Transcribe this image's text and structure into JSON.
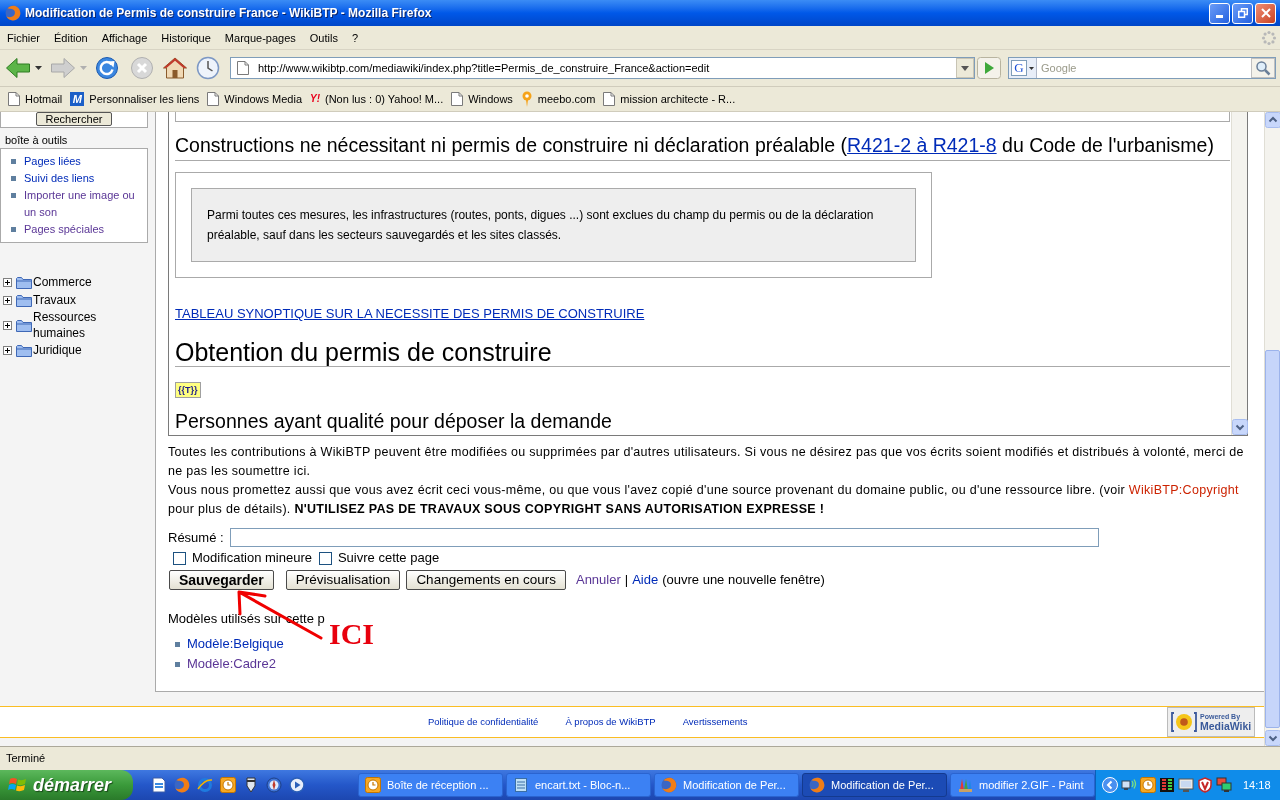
{
  "window": {
    "title": "Modification de Permis de construire France - WikiBTP - Mozilla Firefox"
  },
  "menu": [
    {
      "label": "Fichier"
    },
    {
      "label": "Édition"
    },
    {
      "label": "Affichage"
    },
    {
      "label": "Historique"
    },
    {
      "label": "Marque-pages"
    },
    {
      "label": "Outils"
    },
    {
      "label": "?"
    }
  ],
  "nav_buttons": [
    {
      "kind": "back",
      "disabled": false
    },
    {
      "kind": "forward",
      "disabled": true
    },
    {
      "kind": "reload",
      "disabled": false
    },
    {
      "kind": "stop",
      "disabled": true
    },
    {
      "kind": "home",
      "disabled": false
    },
    {
      "kind": "history",
      "disabled": false
    }
  ],
  "address": {
    "url": "http://www.wikibtp.com/mediawiki/index.php?title=Permis_de_construire_France&action=edit"
  },
  "search": {
    "engine_logo": "G",
    "placeholder": "Google"
  },
  "bookmarks": [
    {
      "label": "Hotmail",
      "kind": "page"
    },
    {
      "label": "Personnaliser les liens",
      "kind": "tile",
      "logo": "M"
    },
    {
      "label": "Windows Media",
      "kind": "page"
    },
    {
      "label": "(Non lus : 0) Yahoo! M...",
      "kind": "wordmark",
      "logo": "Y!"
    },
    {
      "label": "Windows",
      "kind": "page"
    },
    {
      "label": "meebo.com",
      "kind": "pin"
    },
    {
      "label": "mission architecte - R...",
      "kind": "page"
    }
  ],
  "sidebar": {
    "search_button": "Rechercher",
    "toolbox_title": "boîte à outils",
    "toolbox_items": [
      {
        "label": "Pages liées",
        "visited": false
      },
      {
        "label": "Suivi des liens",
        "visited": false
      },
      {
        "label": "Importer une image ou un son",
        "visited": true
      },
      {
        "label": "Pages spéciales",
        "visited": true
      }
    ],
    "tree": [
      {
        "label": "Commerce",
        "expanded": false
      },
      {
        "label": "Travaux",
        "expanded": false
      },
      {
        "label": "Ressources humaines",
        "expanded": false
      },
      {
        "label": "Juridique",
        "expanded": false
      }
    ]
  },
  "editor": {
    "blocks": [
      {
        "kind": "subsection_title",
        "text": "Constructions ne nécessitant ni permis de construire ni déclaration préalable (",
        "link": "R421-2 à R421-8",
        "after": " du Code de l'urbanisme)"
      },
      {
        "kind": "note",
        "text": "Parmi toutes ces mesures, les infrastructures (routes, ponts, digues ...) sont exclues du champ du permis ou de la déclaration préalable, sauf dans les secteurs sauvegardés et les sites classés."
      },
      {
        "kind": "link",
        "text": "TABLEAU SYNOPTIQUE SUR LA NECESSITE DES PERMIS DE CONSTRUIRE"
      },
      {
        "kind": "section_title",
        "text": "Obtention du permis de construire"
      },
      {
        "kind": "template",
        "text": "{{T}}"
      },
      {
        "kind": "subsection_title",
        "text": "Personnes ayant qualité pour déposer la demande"
      }
    ]
  },
  "notice": [
    {
      "text": "Toutes les contributions à WikiBTP peuvent être modifiées ou supprimées par d'autres utilisateurs. Si vous ne désirez pas que vos écrits soient modifiés et distribués à volonté, merci de ne pas les soumettre ici."
    },
    {
      "text": "Vous nous promettez aussi que vous avez écrit ceci vous-même, ou que vous l'avez copié d'une source provenant du domaine public, ou d'une ressource libre. (voir ",
      "link": {
        "text": "WikiBTP:Copyright",
        "missing": true
      },
      "after": " pour plus de détails). **N'UTILISEZ PAS DE TRAVAUX SOUS COPYRIGHT SANS AUTORISATION EXPRESSE !**"
    }
  ],
  "form": {
    "summary_label": "Résumé :",
    "checkboxes": [
      {
        "label": "Modification mineure",
        "checked": false
      },
      {
        "label": "Suivre cette page",
        "checked": false
      }
    ],
    "buttons": [
      {
        "label": "Sauvegarder",
        "kind": "primary"
      },
      {
        "label": "Prévisualisation",
        "kind": "normal"
      },
      {
        "label": "Changements en cours",
        "kind": "normal"
      }
    ],
    "cancel": {
      "text": "Annuler",
      "visited": true
    },
    "separator": "|",
    "help": {
      "text": "Aide",
      "visited": false
    },
    "help_note": "(ouvre une nouvelle fenêtre)"
  },
  "templates": {
    "title": "Modèles utilisés sur cette p",
    "items": [
      {
        "label": "Modèle:Belgique",
        "visited": false
      },
      {
        "label": "Modèle:Cadre2",
        "visited": true
      }
    ]
  },
  "footer": {
    "links": [
      "Politique de confidentialité",
      "À propos de WikiBTP",
      "Avertissements"
    ],
    "badge": {
      "top": "Powered By",
      "bottom": "MediaWiki"
    }
  },
  "annotation": {
    "text": "ICI"
  },
  "status_bar": {
    "text": "Terminé"
  },
  "taskbar": {
    "start": "démarrer",
    "tasks": [
      {
        "label": "Boîte de réception ...",
        "kind": "clock",
        "selected": false
      },
      {
        "label": "encart.txt - Bloc-n...",
        "kind": "notepad",
        "selected": false
      },
      {
        "label": "Modification de Per...",
        "kind": "browser",
        "selected": false
      },
      {
        "label": "Modification de Per...",
        "kind": "browser",
        "selected": true
      },
      {
        "label": "modifier 2.GIF - Paint",
        "kind": "paint",
        "selected": false
      }
    ],
    "clock": "14:18"
  }
}
